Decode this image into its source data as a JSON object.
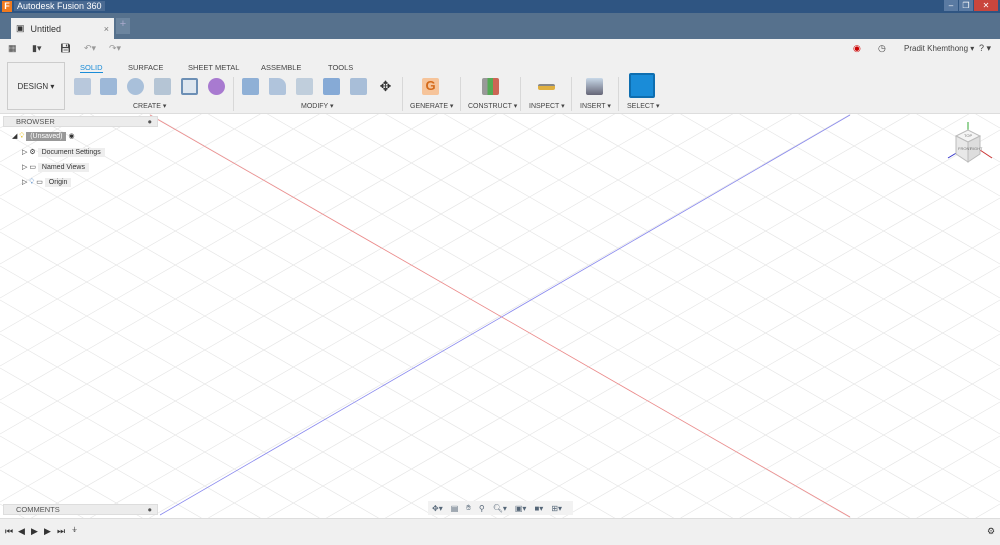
{
  "app": {
    "title": "Autodesk Fusion 360",
    "logo_letter": "F"
  },
  "tabs": {
    "doc": "Untitled",
    "new": "+",
    "close": "×"
  },
  "user": {
    "name": "Pradit Khemthong ▾",
    "help": "? ▾"
  },
  "ribbon": {
    "workspace": "DESIGN ▾",
    "tabs": [
      "SOLID",
      "SURFACE",
      "SHEET METAL",
      "ASSEMBLE",
      "TOOLS"
    ],
    "groups": [
      "CREATE ▾",
      "MODIFY ▾",
      "GENERATE ▾",
      "CONSTRUCT ▾",
      "INSPECT ▾",
      "INSERT ▾",
      "SELECT ▾"
    ]
  },
  "browser": {
    "title": "BROWSER",
    "root": "(Unsaved)",
    "items": [
      "Document Settings",
      "Named Views",
      "Origin"
    ]
  },
  "comments": {
    "title": "COMMENTS"
  },
  "viewcube": {
    "top": "TOP",
    "front": "FRONT",
    "right": "RIGHT"
  },
  "colors": {
    "accent": "#1a8cd8",
    "titlebar": "#2f5582",
    "tabbar": "#56718d",
    "x_axis": "#e88",
    "z_axis": "#88e"
  }
}
